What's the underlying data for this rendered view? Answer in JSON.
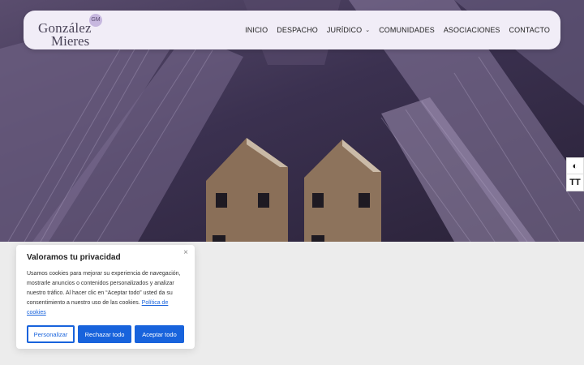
{
  "brand": {
    "line1": "González",
    "line2": "Mieres",
    "badge": "GM"
  },
  "nav": {
    "items": [
      "INICIO",
      "DESPACHO",
      "JURÍDICO",
      "COMUNIDADES",
      "ASOCIACIONES",
      "CONTACTO"
    ],
    "dropdown_chevron": "⌄"
  },
  "accessibility": {
    "contrast_icon": "◐",
    "text_size_icon": "TT"
  },
  "cookie": {
    "title": "Valoramos tu privacidad",
    "body": "Usamos cookies para mejorar su experiencia de navegación, mostrarle anuncios o contenidos personalizados y analizar nuestro tráfico. Al hacer clic en “Aceptar todo” usted da su consentimiento a nuestro uso de las cookies.",
    "policy_link": "Política de cookies",
    "close": "×",
    "customize": "Personalizar",
    "reject": "Rechazar todo",
    "accept": "Aceptar todo"
  },
  "colors": {
    "header_bg": "#f1edf7",
    "hero_tint": "#3b3150",
    "button_blue": "#1863dc"
  }
}
